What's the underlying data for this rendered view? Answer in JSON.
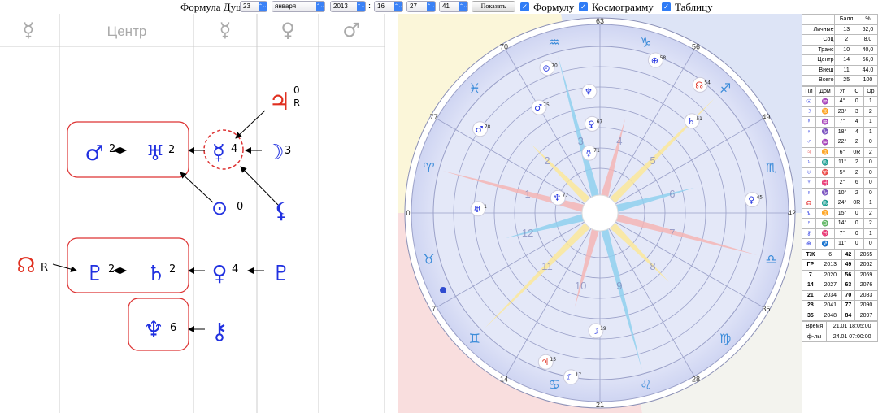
{
  "topbar": {
    "label": "Формула Души:",
    "day": "23",
    "month": "января",
    "year": "2013",
    "sep": ":",
    "hour": "16",
    "minute": "27",
    "second": "41",
    "show_button": "Показать",
    "check_formula": "Формулу",
    "check_cosmogram": "Космограмму",
    "check_table": "Таблицу",
    "check_mark": "✓",
    "arrow": "⌃⌄"
  },
  "formula": {
    "header": [
      "☿",
      "Центр",
      "☿",
      "♀",
      "♂"
    ],
    "nodes": {
      "jupiter": {
        "glyph": "♃",
        "count": "0",
        "retro": "R",
        "color": "#e03020"
      },
      "mercury": {
        "glyph": "☿",
        "count": "4",
        "color": "#2030e0"
      },
      "moon": {
        "glyph": "☽",
        "count": "3",
        "color": "#2030e0"
      },
      "mars": {
        "glyph": "♂",
        "count": "2",
        "color": "#2030e0"
      },
      "uranus": {
        "glyph": "♅",
        "count": "2",
        "color": "#2030e0"
      },
      "sun": {
        "glyph": "⊙",
        "count": "0",
        "color": "#2030e0"
      },
      "lilith": {
        "glyph": "⚸",
        "color": "#2030e0"
      },
      "node": {
        "glyph": "☊",
        "retro": "R",
        "color": "#e03020"
      },
      "pluto": {
        "glyph": "♇",
        "count": "2",
        "color": "#2030e0"
      },
      "saturn": {
        "glyph": "♄",
        "count": "2",
        "color": "#2030e0"
      },
      "venus": {
        "glyph": "♀",
        "count": "4",
        "color": "#2030e0"
      },
      "proserpina": {
        "glyph": "♇",
        "color": "#2030e0"
      },
      "neptune": {
        "glyph": "♆",
        "count": "6",
        "color": "#2030e0"
      },
      "chiron": {
        "glyph": "⚷",
        "color": "#2030e0"
      }
    }
  },
  "chart": {
    "degree_labels": [
      "63",
      "56",
      "49",
      "42",
      "35",
      "28",
      "21",
      "14",
      "7",
      "0",
      "77",
      "70"
    ],
    "signs": [
      "♑",
      "♐",
      "♏",
      "♎",
      "♍",
      "♌",
      "♋",
      "♊",
      "♉",
      "♈",
      "♓",
      "♒"
    ],
    "houses": [
      "1",
      "2",
      "3",
      "4",
      "5",
      "6",
      "7",
      "8",
      "9",
      "10",
      "11",
      "12"
    ],
    "planets": [
      {
        "glyph": "⊙",
        "num": "70",
        "color": "#2030e0"
      },
      {
        "glyph": "♆",
        "num": "",
        "color": "#2030e0"
      },
      {
        "glyph": "⊕",
        "num": "58",
        "color": "#2030e0"
      },
      {
        "glyph": "☊",
        "num": "54",
        "color": "#e03020"
      },
      {
        "glyph": "♄",
        "num": "51",
        "color": "#2030e0"
      },
      {
        "glyph": "♀",
        "num": "67",
        "color": "#2030e0"
      },
      {
        "glyph": "♂",
        "num": "75",
        "color": "#2030e0"
      },
      {
        "glyph": "☿",
        "num": "71",
        "color": "#2030e0"
      },
      {
        "glyph": "♂",
        "num": "78",
        "color": "#2030e0"
      },
      {
        "glyph": "♀",
        "num": "45",
        "color": "#2030e0"
      },
      {
        "glyph": "♆",
        "num": "77",
        "color": "#2030e0"
      },
      {
        "glyph": "♅",
        "num": "1",
        "color": "#2030e0"
      },
      {
        "glyph": "☽",
        "num": "19",
        "color": "#2030e0"
      },
      {
        "glyph": "♃",
        "num": "15",
        "color": "#e03020"
      },
      {
        "glyph": "☾",
        "num": "17",
        "color": "#2030e0"
      }
    ]
  },
  "score_table": {
    "headers": [
      "",
      "Балл",
      "%"
    ],
    "rows": [
      [
        "Личные",
        "13",
        "52,0"
      ],
      [
        "Соц",
        "2",
        "8,0"
      ],
      [
        "Транс",
        "10",
        "40,0"
      ],
      [
        "Центр",
        "14",
        "56,0"
      ],
      [
        "Внеш",
        "11",
        "44,0"
      ],
      [
        "Всего",
        "25",
        "100"
      ]
    ]
  },
  "planet_table": {
    "headers": [
      "Пл",
      "Дом",
      "Уг",
      "С",
      "Ор"
    ],
    "rows": [
      [
        "☉",
        "♒",
        "4°",
        "0",
        "1"
      ],
      [
        "☽",
        "♊",
        "23°",
        "3",
        "2"
      ],
      [
        "☿",
        "♒",
        "7°",
        "4",
        "1"
      ],
      [
        "♀",
        "♑",
        "18°",
        "4",
        "1"
      ],
      [
        "♂",
        "♒",
        "22°",
        "2",
        "0"
      ],
      [
        "♃",
        "♊",
        "6°",
        "0R",
        "2"
      ],
      [
        "♄",
        "♏",
        "11°",
        "2",
        "0"
      ],
      [
        "♅",
        "♈",
        "5°",
        "2",
        "0"
      ],
      [
        "♆",
        "♓",
        "2°",
        "6",
        "0"
      ],
      [
        "♇",
        "♑",
        "10°",
        "2",
        "0"
      ],
      [
        "☊",
        "♏",
        "24°",
        "0R",
        "1"
      ],
      [
        "⚸",
        "♊",
        "15°",
        "0",
        "2"
      ],
      [
        "♇",
        "♎",
        "14°",
        "0",
        "2"
      ],
      [
        "⚷",
        "♓",
        "7°",
        "0",
        "1"
      ],
      [
        "⊕",
        "♐",
        "11°",
        "0",
        "0"
      ]
    ]
  },
  "cycle_table": {
    "rows": [
      [
        "ТЖ",
        "6",
        "42",
        "2055"
      ],
      [
        "ГР",
        "2013",
        "49",
        "2062"
      ],
      [
        "7",
        "2020",
        "56",
        "2069"
      ],
      [
        "14",
        "2027",
        "63",
        "2076"
      ],
      [
        "21",
        "2034",
        "70",
        "2083"
      ],
      [
        "28",
        "2041",
        "77",
        "2090"
      ],
      [
        "35",
        "2048",
        "84",
        "2097"
      ]
    ]
  },
  "footer_table": {
    "rows": [
      [
        "Время",
        "21.01 18:05:00"
      ],
      [
        "ф-лы",
        "24.01 07:00:00"
      ]
    ]
  }
}
